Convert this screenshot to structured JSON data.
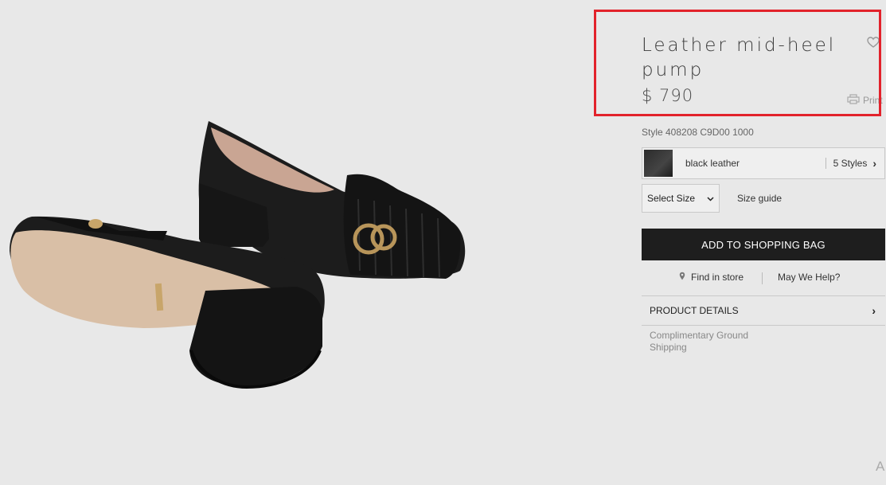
{
  "product": {
    "title": "Leather mid-heel pump",
    "price": "$ 790",
    "style_code": "Style 408208 C9D00 1000",
    "print_label": "Print"
  },
  "color": {
    "name": "black leather",
    "styles_label": "5 Styles"
  },
  "size": {
    "select_label": "Select Size",
    "guide_label": "Size guide"
  },
  "actions": {
    "add_to_bag": "ADD TO SHOPPING BAG",
    "find_in_store": "Find in store",
    "may_we_help": "May We Help?"
  },
  "details": {
    "label": "PRODUCT DETAILS"
  },
  "shipping": {
    "text": "Complimentary Ground Shipping"
  },
  "corner_text": "A",
  "colors": {
    "highlight": "#e2222b",
    "button": "#1e1e1e",
    "background": "#e8e8e8"
  }
}
